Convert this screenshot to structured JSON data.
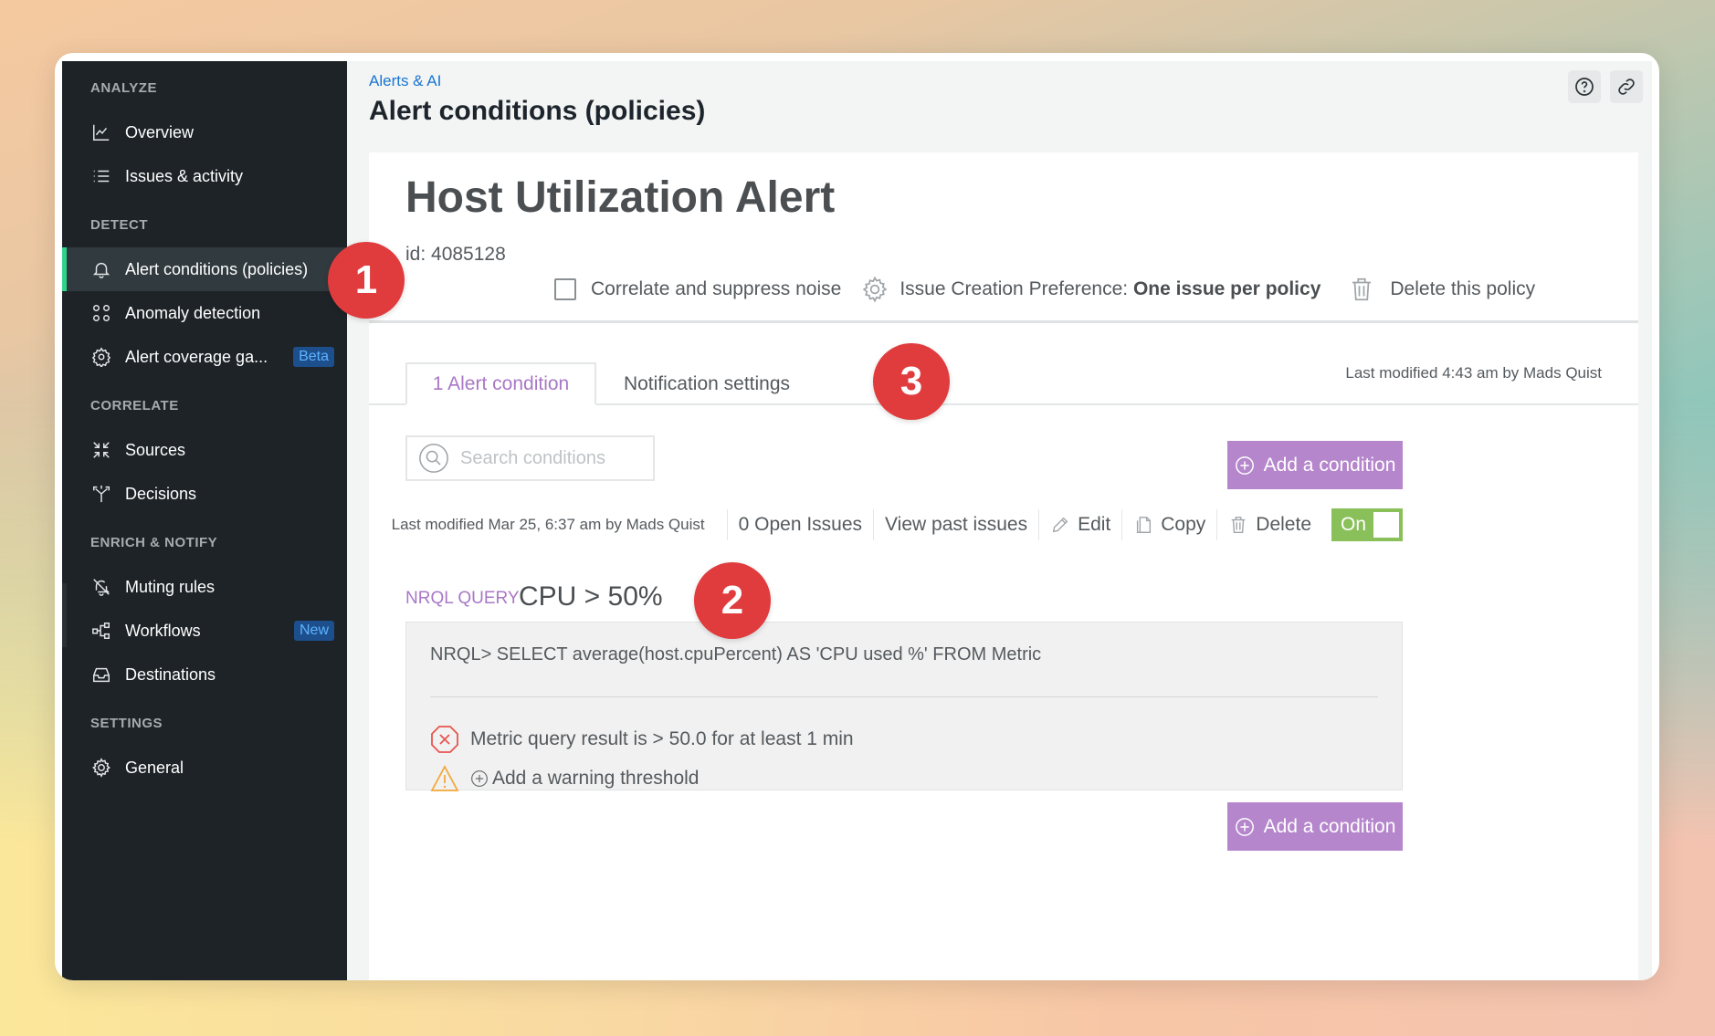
{
  "sidebar": {
    "sections": [
      {
        "title": "ANALYZE",
        "items": [
          {
            "label": "Overview",
            "icon": "chart-icon"
          },
          {
            "label": "Issues & activity",
            "icon": "list-icon"
          }
        ]
      },
      {
        "title": "DETECT",
        "items": [
          {
            "label": "Alert conditions (policies)",
            "icon": "bell-icon",
            "active": true
          },
          {
            "label": "Anomaly detection",
            "icon": "circles-icon"
          },
          {
            "label": "Alert coverage ga...",
            "icon": "gear-puzzle-icon",
            "badge": "Beta"
          }
        ]
      },
      {
        "title": "CORRELATE",
        "items": [
          {
            "label": "Sources",
            "icon": "collapse-arrows-icon"
          },
          {
            "label": "Decisions",
            "icon": "split-arrows-icon"
          }
        ]
      },
      {
        "title": "ENRICH & NOTIFY",
        "items": [
          {
            "label": "Muting rules",
            "icon": "bell-off-icon"
          },
          {
            "label": "Workflows",
            "icon": "workflow-icon",
            "badge": "New"
          },
          {
            "label": "Destinations",
            "icon": "inbox-icon"
          }
        ]
      },
      {
        "title": "SETTINGS",
        "items": [
          {
            "label": "General",
            "icon": "gear-icon"
          }
        ]
      }
    ]
  },
  "header": {
    "breadcrumb": "Alerts & AI",
    "title": "Alert conditions (policies)"
  },
  "policy": {
    "name": "Host Utilization Alert",
    "id": "id: 4085128",
    "correlate_label": "Correlate and suppress noise",
    "issue_pref_label": "Issue Creation Preference:",
    "issue_pref_value": "One issue per policy",
    "delete_label": "Delete this policy",
    "last_modified": "Last modified 4:43 am by Mads Quist"
  },
  "tabs": {
    "conditions": "1 Alert condition",
    "notifications": "Notification settings"
  },
  "search": {
    "placeholder": "Search conditions"
  },
  "add_condition_label": "Add a condition",
  "condition": {
    "last_modified": "Last modified Mar 25, 6:37 am by Mads Quist",
    "open_issues": "0 Open Issues",
    "view_past": "View past issues",
    "edit": "Edit",
    "copy": "Copy",
    "delete": "Delete",
    "toggle": "On",
    "type_label": "NRQL QUERY",
    "name": "CPU > 50%",
    "query": "NRQL> SELECT average(host.cpuPercent) AS 'CPU used %' FROM Metric",
    "critical_threshold": "Metric query result is > 50.0 for at least 1 min",
    "add_warning": "Add a warning threshold"
  },
  "callouts": [
    "1",
    "2",
    "3"
  ],
  "colors": {
    "sidebar_bg": "#1d2327",
    "active_indicator": "#2fd38a",
    "accent_purple": "#b586cc",
    "toggle_green": "#8ac05a",
    "callout_red": "#e03c3e",
    "link_blue": "#1875d1"
  }
}
